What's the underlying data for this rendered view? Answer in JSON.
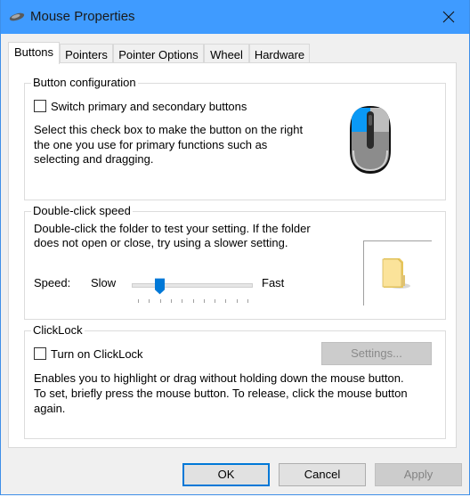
{
  "window": {
    "title": "Mouse Properties",
    "app_icon": "mouse-icon",
    "close_icon": "close-icon",
    "accent_color": "#3f9bff"
  },
  "tabs": [
    {
      "label": "Buttons",
      "active": true
    },
    {
      "label": "Pointers",
      "active": false
    },
    {
      "label": "Pointer Options",
      "active": false
    },
    {
      "label": "Wheel",
      "active": false
    },
    {
      "label": "Hardware",
      "active": false
    }
  ],
  "button_configuration": {
    "group_label": "Button configuration",
    "checkbox_label": "Switch primary and secondary buttons",
    "checked": false,
    "description_lines": [
      "Select this check box to make the button on the right",
      "the one you use for primary functions such as",
      "selecting and dragging."
    ],
    "illustration": "mouse-primary-left-icon"
  },
  "double_click_speed": {
    "group_label": "Double-click speed",
    "description_lines": [
      "Double-click the folder to test your setting. If the folder",
      "does not open or close, try using a slower setting."
    ],
    "speed_label": "Speed:",
    "slow_label": "Slow",
    "fast_label": "Fast",
    "slider": {
      "min": 0,
      "max": 10,
      "value": 2,
      "tick_count": 11
    },
    "test_icon": "folder-icon"
  },
  "clicklock": {
    "group_label": "ClickLock",
    "checkbox_label": "Turn on ClickLock",
    "checked": false,
    "settings_label": "Settings...",
    "settings_enabled": false,
    "description_lines": [
      "Enables you to highlight or drag without holding down the mouse button.",
      "To set, briefly press the mouse button. To release, click the mouse button",
      "again."
    ]
  },
  "footer": {
    "ok_label": "OK",
    "cancel_label": "Cancel",
    "apply_label": "Apply",
    "apply_enabled": false
  }
}
